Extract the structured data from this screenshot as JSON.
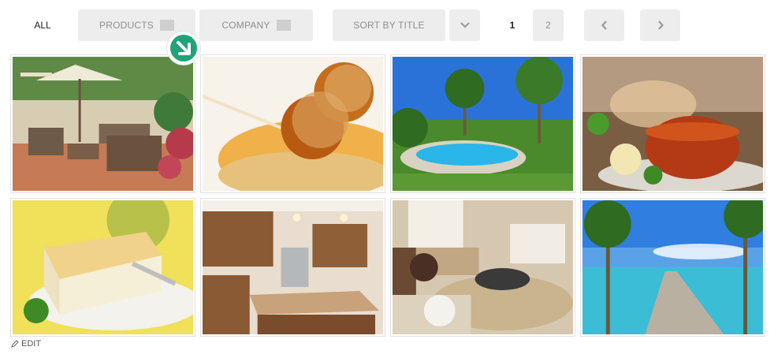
{
  "filters": {
    "all_label": "ALL",
    "products_label": "PRODUCTS",
    "company_label": "COMPANY"
  },
  "sort": {
    "label": "SORT BY TITLE"
  },
  "pagination": {
    "current_page": "1",
    "page_2": "2"
  },
  "gallery": {
    "items": [
      {
        "subject": "patio-furniture",
        "icon": "patio-image"
      },
      {
        "subject": "caramel-apple-pops",
        "icon": "dessert-image"
      },
      {
        "subject": "pool-with-palms",
        "icon": "pool-image"
      },
      {
        "subject": "tea-cups",
        "icon": "tea-image"
      },
      {
        "subject": "cake-slice",
        "icon": "cake-image"
      },
      {
        "subject": "kitchen-interior",
        "icon": "kitchen-image"
      },
      {
        "subject": "living-room",
        "icon": "living-room-image"
      },
      {
        "subject": "beach-pier",
        "icon": "beach-image"
      }
    ]
  },
  "footer": {
    "edit_label": "EDIT"
  },
  "colors": {
    "accent_green": "#20a477",
    "button_bg": "#ededed",
    "button_text": "#8e8e8e"
  }
}
